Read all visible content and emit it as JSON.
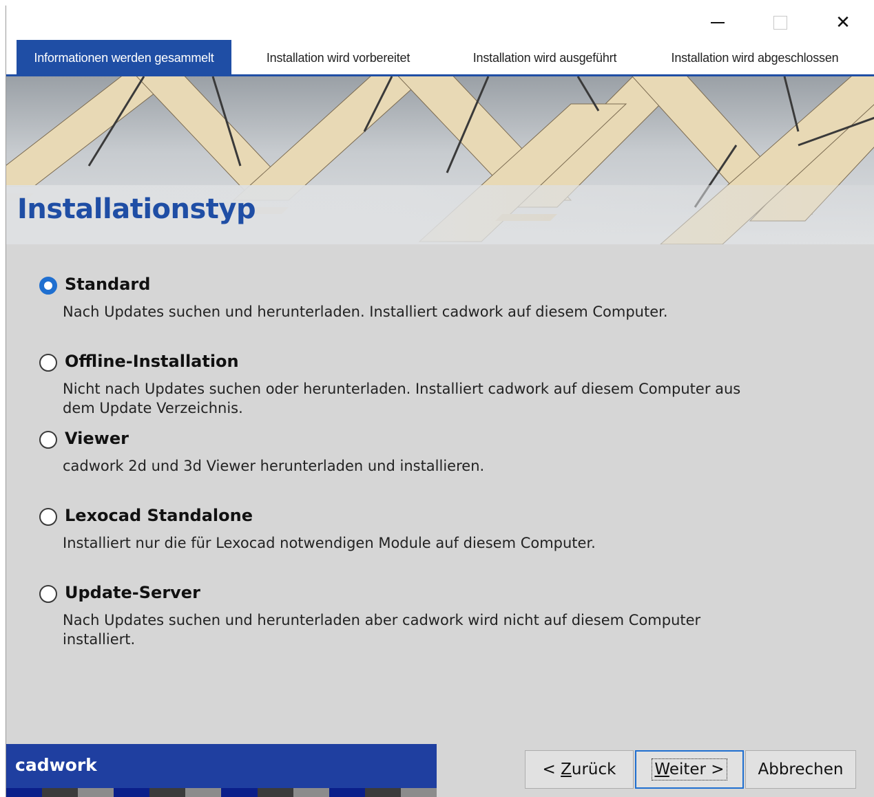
{
  "window": {
    "controls": {
      "minimize": "minimize-icon",
      "maximize": "maximize-icon",
      "close": "close-icon",
      "close_glyph": "✕"
    }
  },
  "steps": [
    {
      "label": "Informationen werden gesammelt",
      "active": true
    },
    {
      "label": "Installation wird vorbereitet",
      "active": false
    },
    {
      "label": "Installation wird ausgeführt",
      "active": false
    },
    {
      "label": "Installation wird abgeschlossen",
      "active": false
    }
  ],
  "page": {
    "title": "Installationstyp"
  },
  "options": [
    {
      "label": "Standard",
      "description": "Nach Updates suchen und herunterladen. Installiert cadwork auf diesem Computer.",
      "selected": true
    },
    {
      "label": "Offline-Installation",
      "description": "Nicht nach Updates suchen oder herunterladen. Installiert cadwork auf diesem Computer aus dem Update Verzeichnis.",
      "selected": false
    },
    {
      "label": "Viewer",
      "description": "cadwork 2d und 3d Viewer herunterladen und installieren.",
      "selected": false
    },
    {
      "label": "Lexocad Standalone",
      "description": "Installiert nur die für Lexocad notwendigen Module auf diesem Computer.",
      "selected": false
    },
    {
      "label": "Update-Server",
      "description": "Nach Updates suchen und herunterladen aber cadwork wird nicht auf diesem Computer installiert.",
      "selected": false
    }
  ],
  "footer": {
    "brand": "cadwork",
    "stripe_colors": [
      "#0a1f8a",
      "#3b3b3b",
      "#8c8c8c",
      "#0a1f8a",
      "#3b3b3b",
      "#8c8c8c",
      "#0a1f8a",
      "#3b3b3b",
      "#8c8c8c",
      "#0a1f8a",
      "#3b3b3b",
      "#8c8c8c"
    ]
  },
  "buttons": {
    "back": {
      "prefix": "< ",
      "mnemonic": "Z",
      "rest": "urück"
    },
    "next": {
      "mnemonic": "W",
      "rest": "eiter >"
    },
    "cancel": {
      "label": "Abbrechen"
    }
  },
  "colors": {
    "accent": "#1f4ea5",
    "radio_selected": "#1f6fd0",
    "background": "#d6d6d6"
  }
}
